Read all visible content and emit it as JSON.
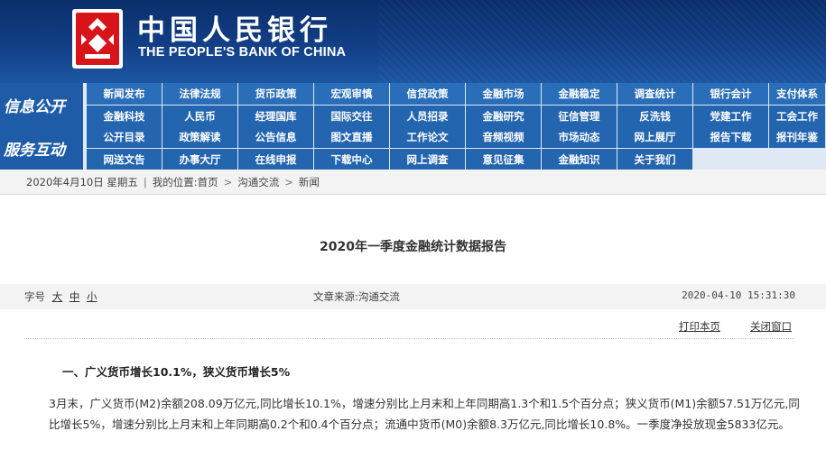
{
  "header": {
    "title_cn": "中国人民银行",
    "title_en": "THE PEOPLE'S BANK OF CHINA"
  },
  "nav": {
    "groups": [
      {
        "label": "信息公开",
        "row1": [
          "新闻发布",
          "法律法规",
          "货币政策",
          "宏观审慎",
          "信贷政策",
          "金融市场",
          "金融稳定",
          "调查统计",
          "银行会计",
          "支付体系"
        ],
        "row2": [
          "金融科技",
          "人民币",
          "经理国库",
          "国际交往",
          "人员招录",
          "金融研究",
          "征信管理",
          "反洗钱",
          "党建工作",
          "工会工作"
        ]
      },
      {
        "label": "服务互动",
        "row1": [
          "公开目录",
          "政策解读",
          "公告信息",
          "图文直播",
          "工作论文",
          "音频视频",
          "市场动态",
          "网上展厅",
          "报告下载",
          "报刊年鉴"
        ],
        "row2": [
          "网送文告",
          "办事大厅",
          "在线申报",
          "下载中心",
          "网上调查",
          "意见征集",
          "金融知识",
          "关于我们"
        ]
      }
    ]
  },
  "breadcrumb": {
    "date": "2020年4月10日  星期五",
    "location_label": "我的位置:",
    "home": "首页",
    "section": "沟通交流",
    "current": "新闻",
    "separator": "|",
    "arrow": ">"
  },
  "article": {
    "title": "2020年一季度金融统计数据报告",
    "font_size_label": "字号",
    "font_size_options": [
      "大",
      "中",
      "小"
    ],
    "source": "文章来源:沟通交流",
    "datetime": "2020-04-10 15:31:30",
    "print_label": "打印本页",
    "close_label": "关闭窗口",
    "section_heading": "一、广义货币增长10.1%，狭义货币增长5%",
    "paragraph": "3月末，广义货币(M2)余额208.09万亿元,同比增长10.1%，增速分别比上月末和上年同期高1.3个和1.5个百分点；狭义货币(M1)余额57.51万亿元,同比增长5%，增速分别比上月末和上年同期高0.2个和0.4个百分点；流通中货币(M0)余额8.3万亿元,同比增长10.8%。一季度净投放现金5833亿元。"
  },
  "colors": {
    "header_bg": "#123f86",
    "nav_item_bg": "#2a6db8",
    "group_label_bg": "#1f5ca8",
    "logo_red": "#d7141a"
  }
}
